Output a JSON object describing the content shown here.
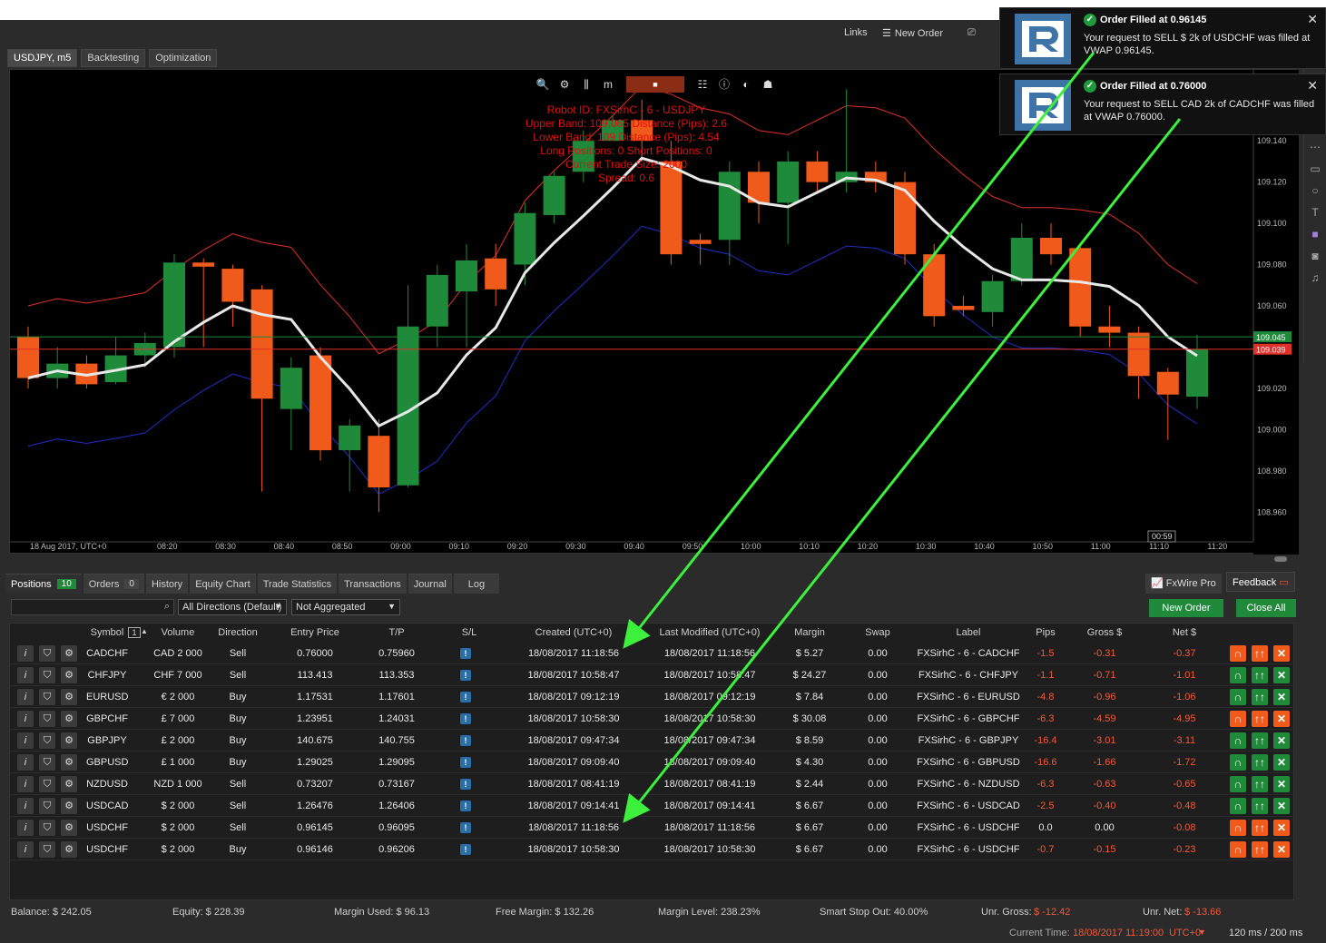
{
  "topbar": {
    "links": "Links",
    "new_order": "New Order"
  },
  "chart_tabs": [
    "USDJPY, m5",
    "Backtesting",
    "Optimization"
  ],
  "chart_info": {
    "lines": [
      "Robot ID: FXSirhC - 6 - USDJPY",
      "Upper Band: 109.065 Distance (Pips): 2.6",
      "Lower Band: 109 Distance (Pips): 4.54",
      "Long Positions: 0 Short Positions: 0",
      "Current Trade Size: 2000",
      "Spread: 0.6"
    ]
  },
  "chart_data": {
    "type": "candlestick",
    "symbol": "USDJPY, m5",
    "x_ticks": [
      "18 Aug 2017, UTC+0",
      "08:20",
      "08:30",
      "08:40",
      "08:50",
      "09:00",
      "09:10",
      "09:20",
      "09:30",
      "09:40",
      "09:50",
      "10:00",
      "10:10",
      "10:20",
      "10:30",
      "10:40",
      "10:50",
      "11:00",
      "11:10",
      "11:20"
    ],
    "y_ticks": [
      "109.140",
      "109.120",
      "109.100",
      "109.080",
      "109.060",
      "109.020",
      "109.000",
      "108.980",
      "108.960"
    ],
    "ylim": [
      108.95,
      109.17
    ],
    "price_labels": [
      {
        "value": 109.045,
        "text": "109.045",
        "color": "#1f8a3a"
      },
      {
        "value": 109.039,
        "text": "109.039",
        "color": "#e0302a"
      }
    ],
    "countdown": "00:59",
    "candles": [
      {
        "o": 109.045,
        "h": 109.05,
        "c": 109.025,
        "l": 109.02
      },
      {
        "o": 109.025,
        "h": 109.04,
        "c": 109.032,
        "l": 109.02
      },
      {
        "o": 109.032,
        "h": 109.036,
        "c": 109.022,
        "l": 109.02
      },
      {
        "o": 109.023,
        "h": 109.045,
        "c": 109.036,
        "l": 109.022
      },
      {
        "o": 109.036,
        "h": 109.047,
        "c": 109.042,
        "l": 109.03
      },
      {
        "o": 109.04,
        "h": 109.085,
        "c": 109.081,
        "l": 109.035
      },
      {
        "o": 109.081,
        "h": 109.083,
        "c": 109.079,
        "l": 109.04
      },
      {
        "o": 109.078,
        "h": 109.08,
        "c": 109.062,
        "l": 109.05
      },
      {
        "o": 109.068,
        "h": 109.07,
        "c": 109.015,
        "l": 108.97
      },
      {
        "o": 109.01,
        "h": 109.035,
        "c": 109.03,
        "l": 108.99
      },
      {
        "o": 109.036,
        "h": 109.04,
        "c": 108.99,
        "l": 108.985
      },
      {
        "o": 108.99,
        "h": 109.005,
        "c": 109.002,
        "l": 108.97
      },
      {
        "o": 108.997,
        "h": 109.005,
        "c": 108.972,
        "l": 108.96
      },
      {
        "o": 108.973,
        "h": 109.07,
        "c": 109.05,
        "l": 108.972
      },
      {
        "o": 109.05,
        "h": 109.08,
        "c": 109.075,
        "l": 109.04
      },
      {
        "o": 109.067,
        "h": 109.09,
        "c": 109.082,
        "l": 109.04
      },
      {
        "o": 109.083,
        "h": 109.09,
        "c": 109.068,
        "l": 109.06
      },
      {
        "o": 109.08,
        "h": 109.11,
        "c": 109.105,
        "l": 109.07
      },
      {
        "o": 109.104,
        "h": 109.125,
        "c": 109.123,
        "l": 109.1
      },
      {
        "o": 109.125,
        "h": 109.145,
        "c": 109.14,
        "l": 109.12
      },
      {
        "o": 109.14,
        "h": 109.152,
        "c": 109.15,
        "l": 109.14
      },
      {
        "o": 109.15,
        "h": 109.16,
        "c": 109.14,
        "l": 109.13
      },
      {
        "o": 109.13,
        "h": 109.14,
        "c": 109.085,
        "l": 109.08
      },
      {
        "o": 109.092,
        "h": 109.095,
        "c": 109.09,
        "l": 109.08
      },
      {
        "o": 109.092,
        "h": 109.13,
        "c": 109.125,
        "l": 109.08
      },
      {
        "o": 109.125,
        "h": 109.13,
        "c": 109.11,
        "l": 109.1
      },
      {
        "o": 109.11,
        "h": 109.135,
        "c": 109.13,
        "l": 109.09
      },
      {
        "o": 109.13,
        "h": 109.135,
        "c": 109.12,
        "l": 109.115
      },
      {
        "o": 109.12,
        "h": 109.165,
        "c": 109.125,
        "l": 109.115
      },
      {
        "o": 109.125,
        "h": 109.13,
        "c": 109.12,
        "l": 109.115
      },
      {
        "o": 109.12,
        "h": 109.125,
        "c": 109.085,
        "l": 109.08
      },
      {
        "o": 109.085,
        "h": 109.09,
        "c": 109.055,
        "l": 109.05
      },
      {
        "o": 109.06,
        "h": 109.065,
        "c": 109.058,
        "l": 109.055
      },
      {
        "o": 109.057,
        "h": 109.075,
        "c": 109.072,
        "l": 109.05
      },
      {
        "o": 109.072,
        "h": 109.1,
        "c": 109.093,
        "l": 109.07
      },
      {
        "o": 109.093,
        "h": 109.1,
        "c": 109.085,
        "l": 109.08
      },
      {
        "o": 109.088,
        "h": 109.09,
        "c": 109.05,
        "l": 109.045
      },
      {
        "o": 109.05,
        "h": 109.06,
        "c": 109.047,
        "l": 109.04
      },
      {
        "o": 109.047,
        "h": 109.05,
        "c": 109.026,
        "l": 109.015
      },
      {
        "o": 109.028,
        "h": 109.03,
        "c": 109.017,
        "l": 108.995
      },
      {
        "o": 109.016,
        "h": 109.046,
        "c": 109.039,
        "l": 109.01
      }
    ]
  },
  "bottom_tabs": [
    {
      "label": "Positions",
      "badge": "10"
    },
    {
      "label": "Orders",
      "badge": "0"
    },
    {
      "label": "History"
    },
    {
      "label": "Equity Chart"
    },
    {
      "label": "Trade Statistics"
    },
    {
      "label": "Transactions"
    },
    {
      "label": "Journal"
    },
    {
      "label": "Log"
    }
  ],
  "fxwire": "FxWire Pro",
  "feedback": "Feedback",
  "filters": {
    "direction": "All Directions (Default)",
    "aggregation": "Not Aggregated",
    "new_order": "New Order",
    "close_all": "Close All"
  },
  "grid": {
    "columns": [
      "Symbol",
      "Volume",
      "Direction",
      "Entry Price",
      "T/P",
      "S/L",
      "Created (UTC+0)",
      "Last Modified (UTC+0)",
      "Margin",
      "Swap",
      "Label",
      "Pips",
      "Gross $",
      "Net $"
    ],
    "sort_badge": "1",
    "rows": [
      {
        "symbol": "CADCHF",
        "volume": "CAD 2 000",
        "direction": "Sell",
        "entry": "0.76000",
        "tp": "0.75960",
        "created": "18/08/2017 11:18:56",
        "modified": "18/08/2017 11:18:56",
        "margin": "$ 5.27",
        "swap": "0.00",
        "label": "FXSirhC - 6 - CADCHF",
        "pips": "-1.5",
        "gross": "-0.31",
        "net": "-0.37",
        "first_action": "o"
      },
      {
        "symbol": "CHFJPY",
        "volume": "CHF 7 000",
        "direction": "Sell",
        "entry": "113.413",
        "tp": "113.353",
        "created": "18/08/2017 10:58:47",
        "modified": "18/08/2017 10:58:47",
        "margin": "$ 24.27",
        "swap": "0.00",
        "label": "FXSirhC - 6 - CHFJPY",
        "pips": "-1.1",
        "gross": "-0.71",
        "net": "-1.01",
        "first_action": "g"
      },
      {
        "symbol": "EURUSD",
        "volume": "€ 2 000",
        "direction": "Buy",
        "entry": "1.17531",
        "tp": "1.17601",
        "created": "18/08/2017 09:12:19",
        "modified": "18/08/2017 09:12:19",
        "margin": "$ 7.84",
        "swap": "0.00",
        "label": "FXSirhC - 6 - EURUSD",
        "pips": "-4.8",
        "gross": "-0.96",
        "net": "-1.06",
        "first_action": "g"
      },
      {
        "symbol": "GBPCHF",
        "volume": "£ 7 000",
        "direction": "Buy",
        "entry": "1.23951",
        "tp": "1.24031",
        "created": "18/08/2017 10:58:30",
        "modified": "18/08/2017 10:58:30",
        "margin": "$ 30.08",
        "swap": "0.00",
        "label": "FXSirhC - 6 - GBPCHF",
        "pips": "-6.3",
        "gross": "-4.59",
        "net": "-4.95",
        "first_action": "o"
      },
      {
        "symbol": "GBPJPY",
        "volume": "£ 2 000",
        "direction": "Buy",
        "entry": "140.675",
        "tp": "140.755",
        "created": "18/08/2017 09:47:34",
        "modified": "18/08/2017 09:47:34",
        "margin": "$ 8.59",
        "swap": "0.00",
        "label": "FXSirhC - 6 - GBPJPY",
        "pips": "-16.4",
        "gross": "-3.01",
        "net": "-3.11",
        "first_action": "g"
      },
      {
        "symbol": "GBPUSD",
        "volume": "£ 1 000",
        "direction": "Buy",
        "entry": "1.29025",
        "tp": "1.29095",
        "created": "18/08/2017 09:09:40",
        "modified": "18/08/2017 09:09:40",
        "margin": "$ 4.30",
        "swap": "0.00",
        "label": "FXSirhC - 6 - GBPUSD",
        "pips": "-16.6",
        "gross": "-1.66",
        "net": "-1.72",
        "first_action": "g"
      },
      {
        "symbol": "NZDUSD",
        "volume": "NZD 1 000",
        "direction": "Sell",
        "entry": "0.73207",
        "tp": "0.73167",
        "created": "18/08/2017 08:41:19",
        "modified": "18/08/2017 08:41:19",
        "margin": "$ 2.44",
        "swap": "0.00",
        "label": "FXSirhC - 6 - NZDUSD",
        "pips": "-6.3",
        "gross": "-0.63",
        "net": "-0.65",
        "first_action": "g"
      },
      {
        "symbol": "USDCAD",
        "volume": "$ 2 000",
        "direction": "Sell",
        "entry": "1.26476",
        "tp": "1.26406",
        "created": "18/08/2017 09:14:41",
        "modified": "18/08/2017 09:14:41",
        "margin": "$ 6.67",
        "swap": "0.00",
        "label": "FXSirhC - 6 - USDCAD",
        "pips": "-2.5",
        "gross": "-0.40",
        "net": "-0.48",
        "first_action": "g"
      },
      {
        "symbol": "USDCHF",
        "volume": "$ 2 000",
        "direction": "Sell",
        "entry": "0.96145",
        "tp": "0.96095",
        "created": "18/08/2017 11:18:56",
        "modified": "18/08/2017 11:18:56",
        "margin": "$ 6.67",
        "swap": "0.00",
        "label": "FXSirhC - 6 - USDCHF",
        "pips": "0.0",
        "gross": "0.00",
        "net": "-0.08",
        "first_action": "o"
      },
      {
        "symbol": "USDCHF",
        "volume": "$ 2 000",
        "direction": "Buy",
        "entry": "0.96146",
        "tp": "0.96206",
        "created": "18/08/2017 10:58:30",
        "modified": "18/08/2017 10:58:30",
        "margin": "$ 6.67",
        "swap": "0.00",
        "label": "FXSirhC - 6 - USDCHF",
        "pips": "-0.7",
        "gross": "-0.15",
        "net": "-0.23",
        "first_action": "o"
      }
    ]
  },
  "status": {
    "balance": "Balance: $ 242.05",
    "equity": "Equity: $ 228.39",
    "margin_used": "Margin Used: $ 96.13",
    "free_margin": "Free Margin: $ 132.26",
    "margin_level": "Margin Level: 238.23%",
    "smart_stop": "Smart Stop Out: 40.00%",
    "unr_gross_label": "Unr. Gross:",
    "unr_gross_value": "$ -12.42",
    "unr_net_label": "Unr. Net:",
    "unr_net_value": "$ -13.66"
  },
  "footer": {
    "time_label": "Current Time:",
    "time_value": "18/08/2017 11:19:00",
    "tz": "UTC+0",
    "latency": "120 ms / 200 ms"
  },
  "notifications": [
    {
      "title": "Order Filled at 0.96145",
      "body": "Your request to SELL $ 2k of USDCHF was filled at VWAP 0.96145."
    },
    {
      "title": "Order Filled at 0.76000",
      "body": "Your request to SELL CAD 2k of CADCHF was filled at VWAP 0.76000."
    }
  ],
  "colors": {
    "bull": "#1f8a3a",
    "bear": "#f05a1a",
    "upper_band": "#e0302a",
    "lower_band": "#1f2fc8",
    "mid": "#e8e8e8",
    "arrow": "#3cf03c"
  }
}
